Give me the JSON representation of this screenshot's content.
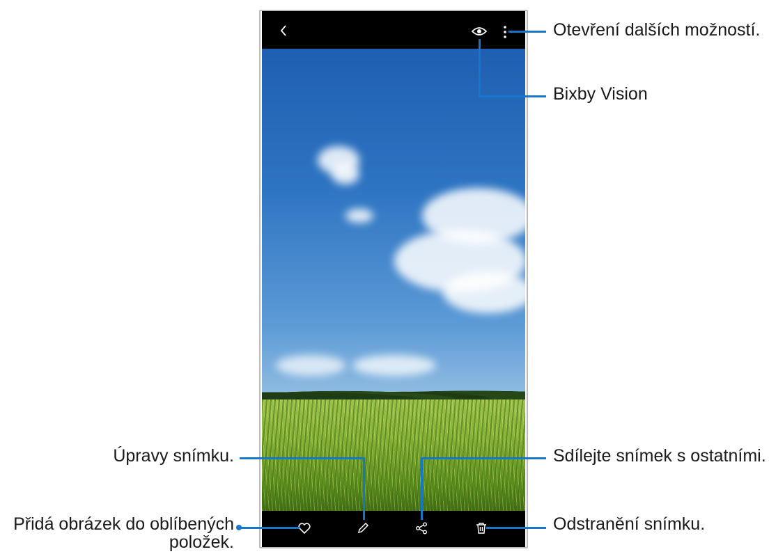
{
  "callouts": {
    "more_options": "Otevření dalších možností.",
    "bixby_vision": "Bixby Vision",
    "edit": "Úpravy snímku.",
    "share": "Sdílejte snímek s ostatními.",
    "favorite_line1": "Přidá obrázek do oblíbených",
    "favorite_line2": "položek.",
    "delete": "Odstranění snímku."
  },
  "toolbar": {
    "icons": [
      "back-icon",
      "eye-icon",
      "more-vertical-icon"
    ]
  },
  "bottom_bar": {
    "icons": [
      "heart-icon",
      "pencil-icon",
      "share-icon",
      "trash-icon"
    ]
  },
  "colors": {
    "accent": "#1677c9",
    "bar": "#000000"
  }
}
